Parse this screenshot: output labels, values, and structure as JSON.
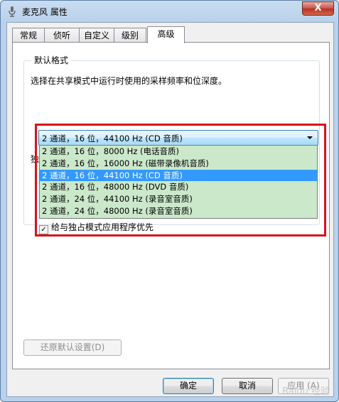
{
  "window": {
    "title": "麦克风 属性",
    "close_glyph": "X"
  },
  "tabs": [
    {
      "label": "常规"
    },
    {
      "label": "侦听"
    },
    {
      "label": "自定义"
    },
    {
      "label": "级别"
    },
    {
      "label": "高级"
    }
  ],
  "default_format": {
    "group_title": "默认格式",
    "description": "选择在共享模式中运行时使用的采样频率和位深度。",
    "selected_value": "2 通道，16 位，44100 Hz (CD 音质)",
    "options": [
      "2 通道，16 位，8000 Hz (电话音质)",
      "2 通道，16 位，16000 Hz (磁带录像机音质)",
      "2 通道，16 位，44100 Hz (CD 音质)",
      "2 通道，16 位，48000 Hz (DVD 音质)",
      "2 通道，24 位，44100 Hz (录音室音质)",
      "2 通道，24 位，48000 Hz (录音室音质)"
    ],
    "selected_index": 2
  },
  "exclusive": {
    "partial_label": "独",
    "priority_label": "给与独占模式应用程序优先",
    "priority_checked": true
  },
  "buttons": {
    "restore_defaults": "还原默认设置(D)",
    "ok": "确定",
    "cancel": "取消",
    "apply": "应用 (A)"
  },
  "watermark": "Baidu 经验"
}
